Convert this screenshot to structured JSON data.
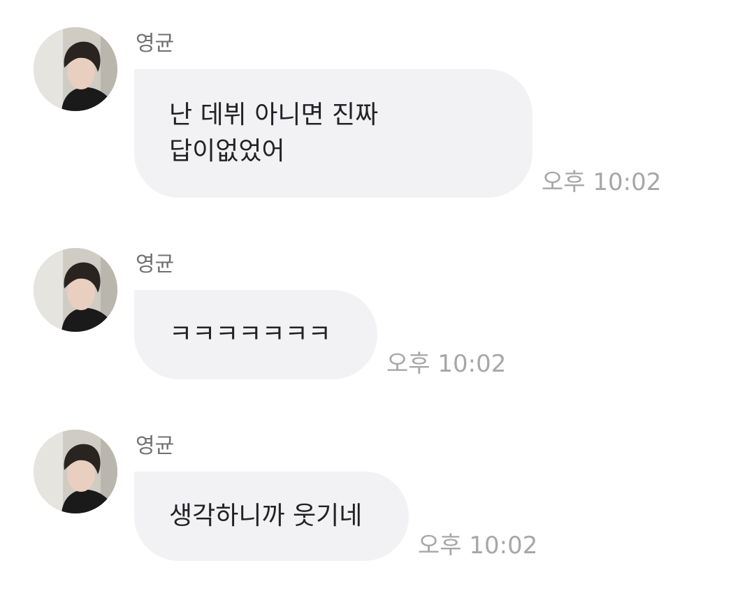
{
  "messages": [
    {
      "sender": "영균",
      "text": "난 데뷔 아니면 진짜\n답이없었어",
      "time": "오후 10:02"
    },
    {
      "sender": "영균",
      "text": "ㅋㅋㅋㅋㅋㅋㅋ",
      "time": "오후 10:02"
    },
    {
      "sender": "영균",
      "text": "생각하니까 웃기네",
      "time": "오후 10:02"
    }
  ]
}
